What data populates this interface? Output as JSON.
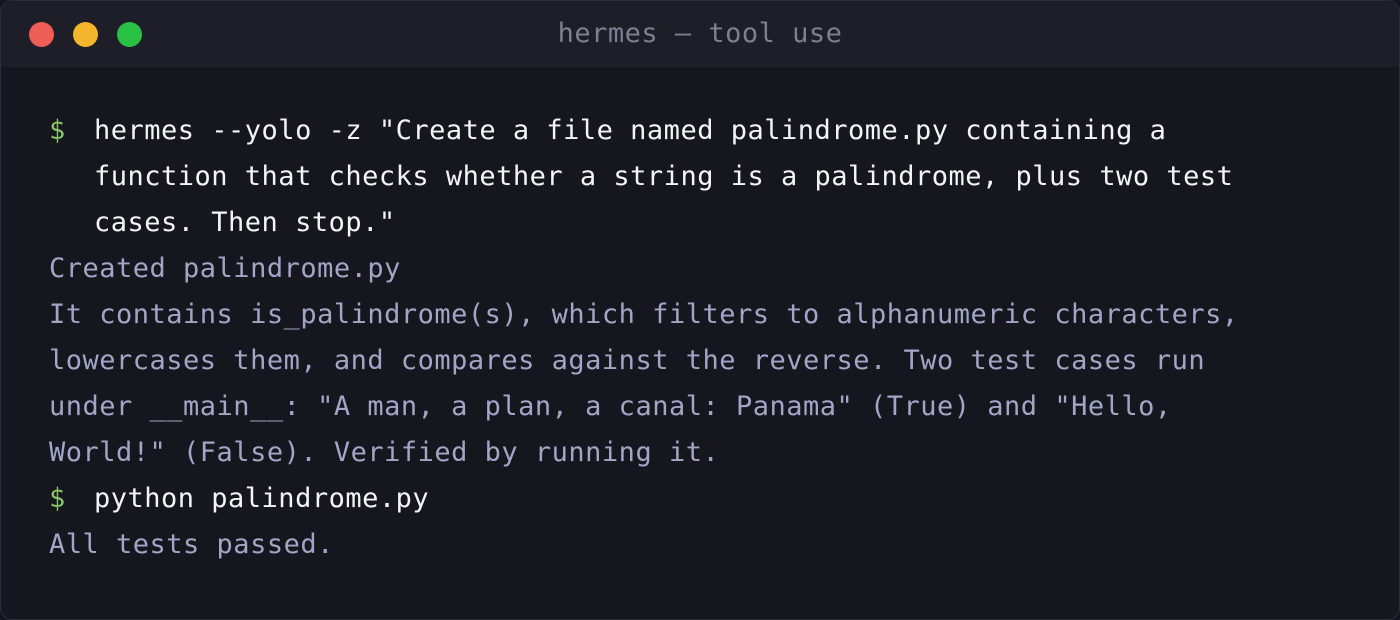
{
  "window": {
    "title": "hermes — tool use",
    "colors": {
      "close": "#ee5d56",
      "minimize": "#f4b42b",
      "zoom": "#28c144",
      "prompt": "#8cc46a",
      "command": "#f4f4f8",
      "output": "#a2a6c6"
    }
  },
  "terminal": {
    "prompt_symbol": "$",
    "command1": {
      "lines": [
        "hermes --yolo -z \"Create a file named palindrome.py containing a",
        "function that checks whether a string is a palindrome, plus two test",
        "cases. Then stop.\""
      ]
    },
    "output1": [
      "Created palindrome.py",
      "It contains is_palindrome(s), which filters to alphanumeric characters,",
      "lowercases them, and compares against the reverse. Two test cases run",
      "under __main__: \"A man, a plan, a canal: Panama\" (True) and \"Hello,",
      "World!\" (False). Verified by running it."
    ],
    "command2": {
      "lines": [
        "python palindrome.py"
      ]
    },
    "output2": [
      "All tests passed."
    ]
  }
}
